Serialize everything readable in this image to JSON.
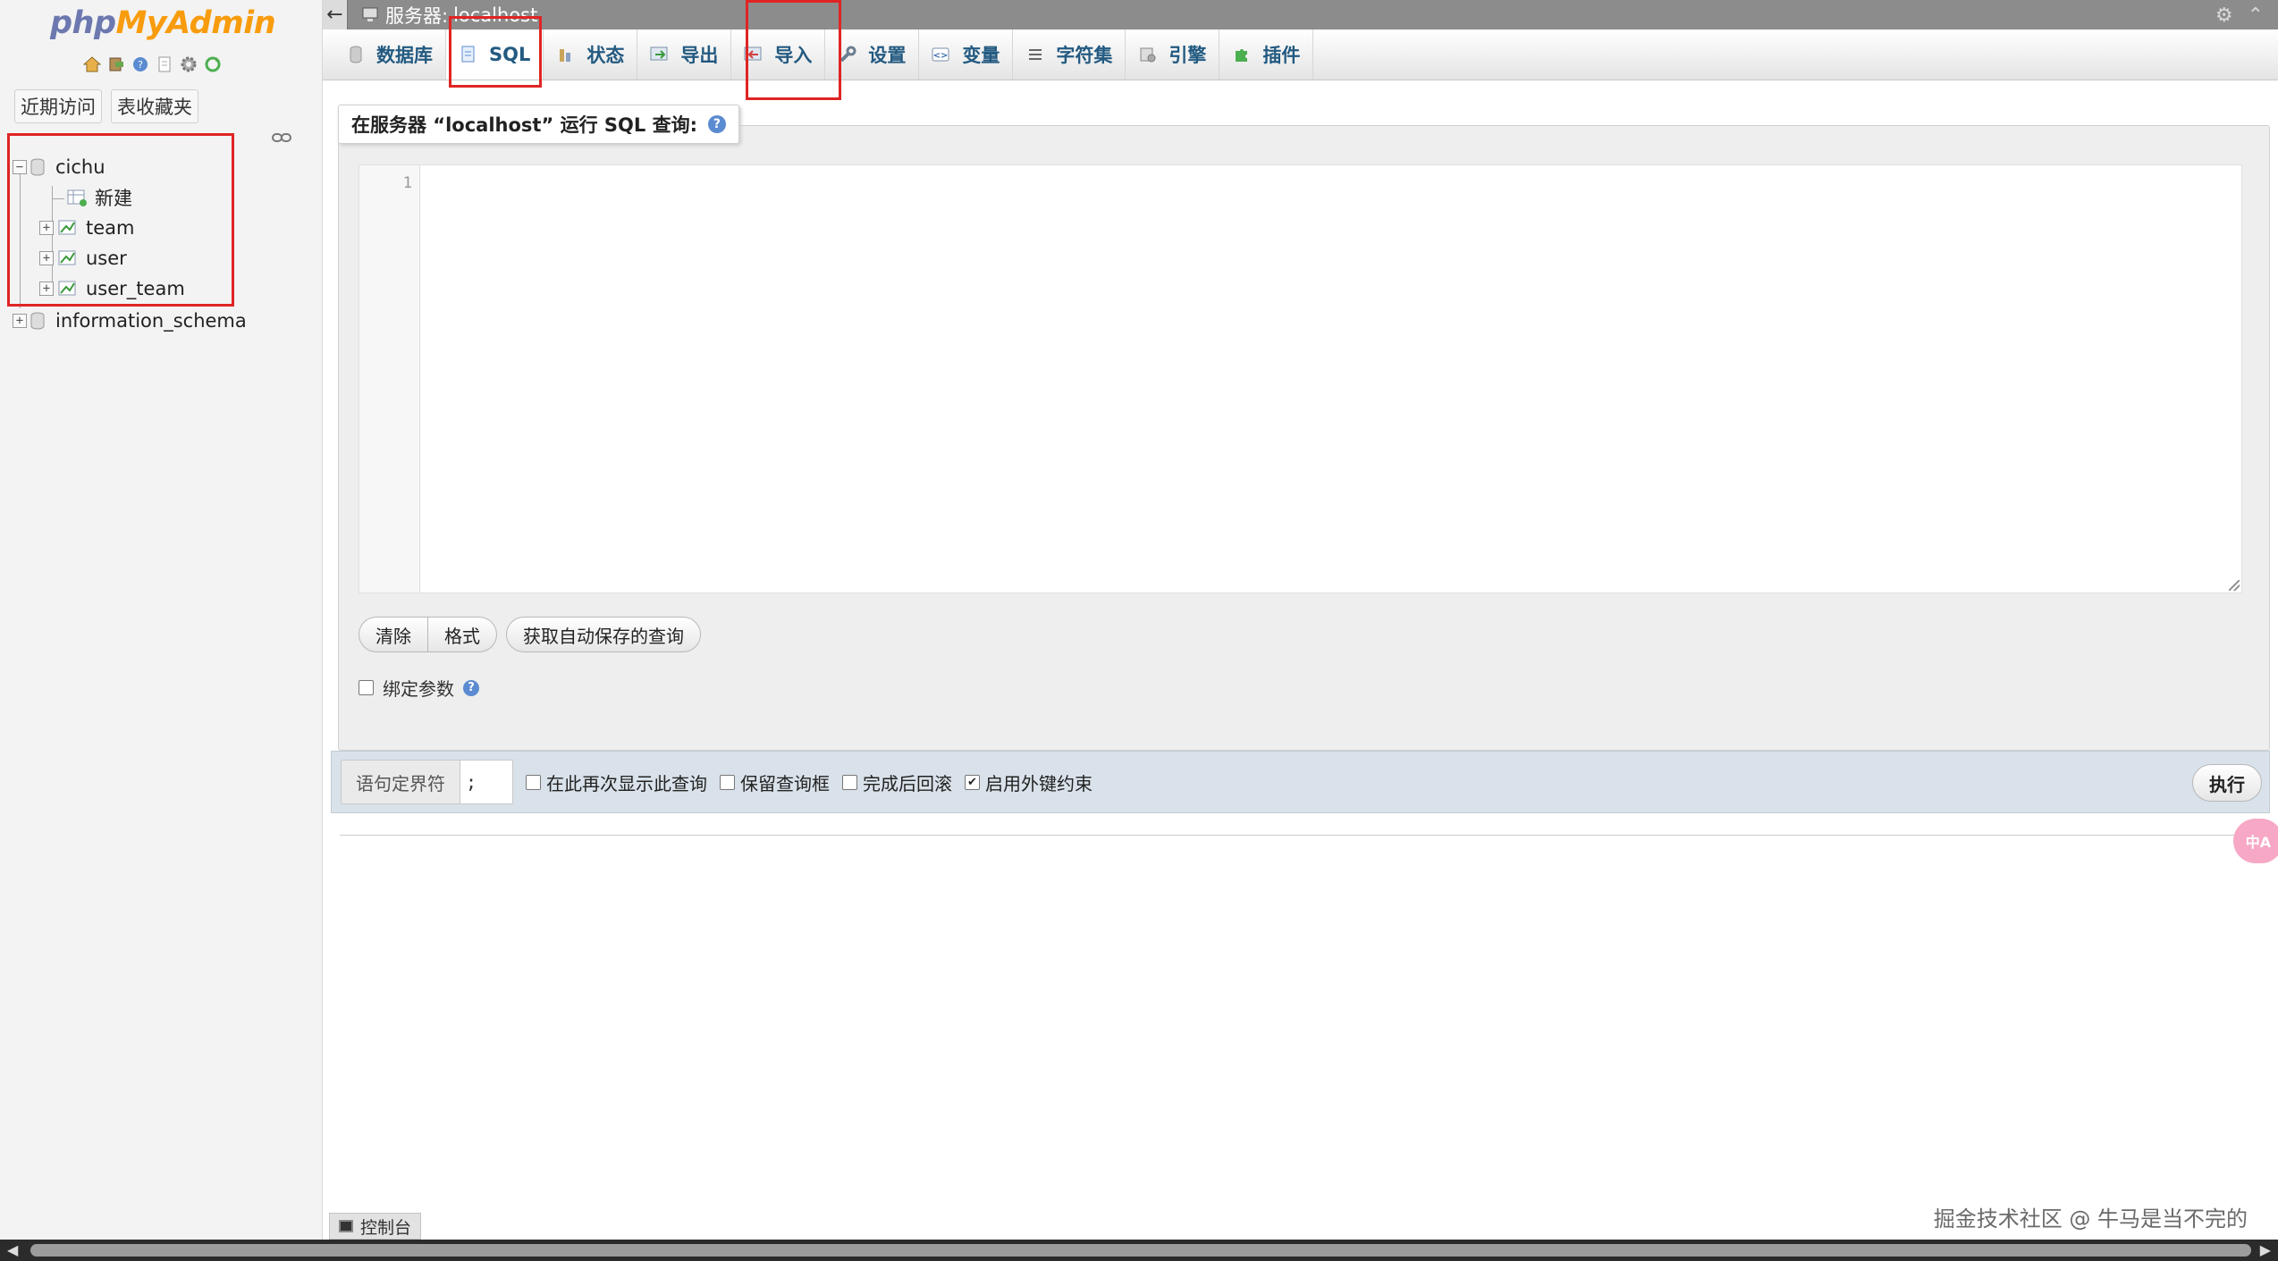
{
  "logo": {
    "part1": "php",
    "part2": "MyAdmin"
  },
  "nav": {
    "tabs": [
      "近期访问",
      "表收藏夹"
    ],
    "tree": {
      "db1": "cichu",
      "new_item": "新建",
      "tables": [
        "team",
        "user",
        "user_team"
      ],
      "db2": "information_schema"
    }
  },
  "serverbar": {
    "back": "←",
    "label": "服务器:",
    "server": "localhost"
  },
  "tabs": [
    "数据库",
    "SQL",
    "状态",
    "导出",
    "导入",
    "设置",
    "变量",
    "字符集",
    "引擎",
    "插件"
  ],
  "query": {
    "legend": "在服务器 “localhost” 运行 SQL 查询:",
    "line_number": "1",
    "clear": "清除",
    "format": "格式",
    "autosave": "获取自动保存的查询",
    "bind_params": "绑定参数"
  },
  "options": {
    "delimiter_label": "语句定界符",
    "delimiter_value": ";",
    "show_again": "在此再次显示此查询",
    "retain_box": "保留查询框",
    "rollback": "完成后回滚",
    "fk_checks": "启用外键约束",
    "go": "执行"
  },
  "console": "控制台",
  "translate_fab": "中A",
  "watermark": "掘金技术社区 @ 牛马是当不完的"
}
